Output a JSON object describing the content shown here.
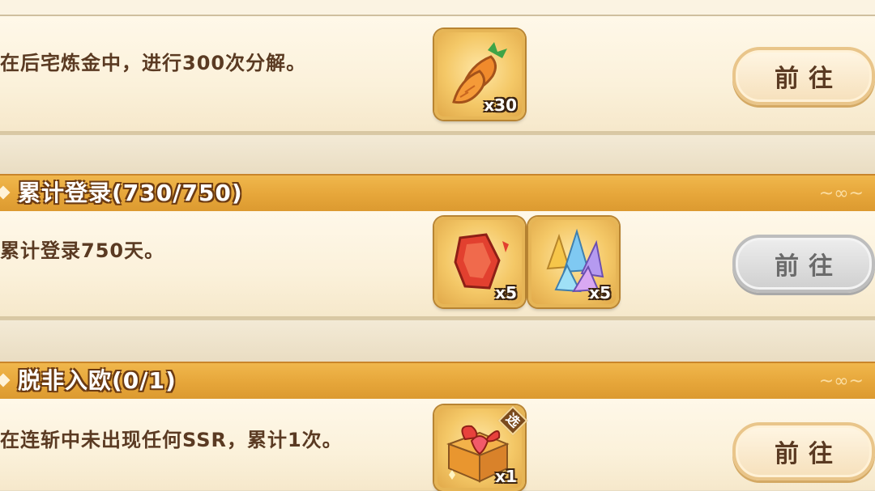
{
  "tasks": [
    {
      "title": "",
      "description": "在后宅炼金中，进行300次分解。",
      "rewards": [
        {
          "icon": "carrot-icon",
          "qty": "x30"
        }
      ],
      "button": {
        "label": "前往",
        "state": "active"
      }
    },
    {
      "title": "累计登录(730/750)",
      "description": "累计登录750天。",
      "rewards": [
        {
          "icon": "red-stone-icon",
          "qty": "x5"
        },
        {
          "icon": "crystal-icon",
          "qty": "x5"
        }
      ],
      "button": {
        "label": "前往",
        "state": "disabled"
      }
    },
    {
      "title": "脱非入欧(0/1)",
      "description": "在连斩中未出现任何SSR，累计1次。",
      "rewards": [
        {
          "icon": "gift-box-icon",
          "qty": "x1",
          "badge": "选"
        }
      ],
      "button": {
        "label": "前往",
        "state": "active"
      }
    }
  ],
  "colors": {
    "header": "#e6a63a",
    "text": "#5a3a22",
    "panel": "#fbf1da"
  }
}
